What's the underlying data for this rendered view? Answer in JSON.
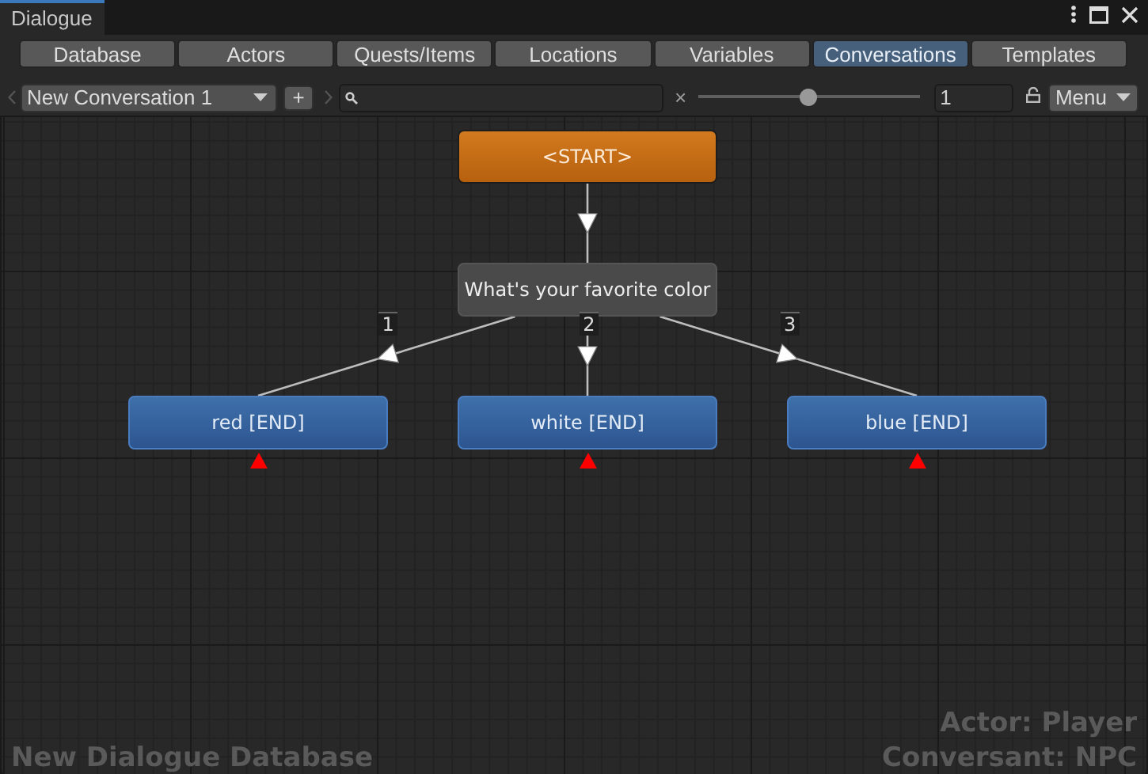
{
  "window": {
    "title": "Dialogue"
  },
  "tabs": [
    {
      "label": "Database",
      "selected": false
    },
    {
      "label": "Actors",
      "selected": false
    },
    {
      "label": "Quests/Items",
      "selected": false
    },
    {
      "label": "Locations",
      "selected": false
    },
    {
      "label": "Variables",
      "selected": false
    },
    {
      "label": "Conversations",
      "selected": true
    },
    {
      "label": "Templates",
      "selected": false
    }
  ],
  "toolbar": {
    "conversation": "New Conversation 1",
    "add_button": "+",
    "clear_button": "×",
    "zoom": {
      "level": 0.5
    },
    "zoom_value": "1",
    "menu": "Menu"
  },
  "graph": {
    "root": {
      "kind": "start",
      "text": "<START>",
      "children": [
        {
          "kind": "npc",
          "text": "What's your favorite color",
          "children": [
            {
              "kind": "player",
              "text": "red [END]",
              "link": "1",
              "warning": true
            },
            {
              "kind": "player",
              "text": "white [END]",
              "link": "2",
              "warning": true
            },
            {
              "kind": "player",
              "text": "blue [END]",
              "link": "3",
              "warning": true
            }
          ]
        }
      ]
    }
  },
  "footer": {
    "database": "New Dialogue Database",
    "actor": "Actor: Player",
    "conversant": "Conversant: NPC"
  }
}
